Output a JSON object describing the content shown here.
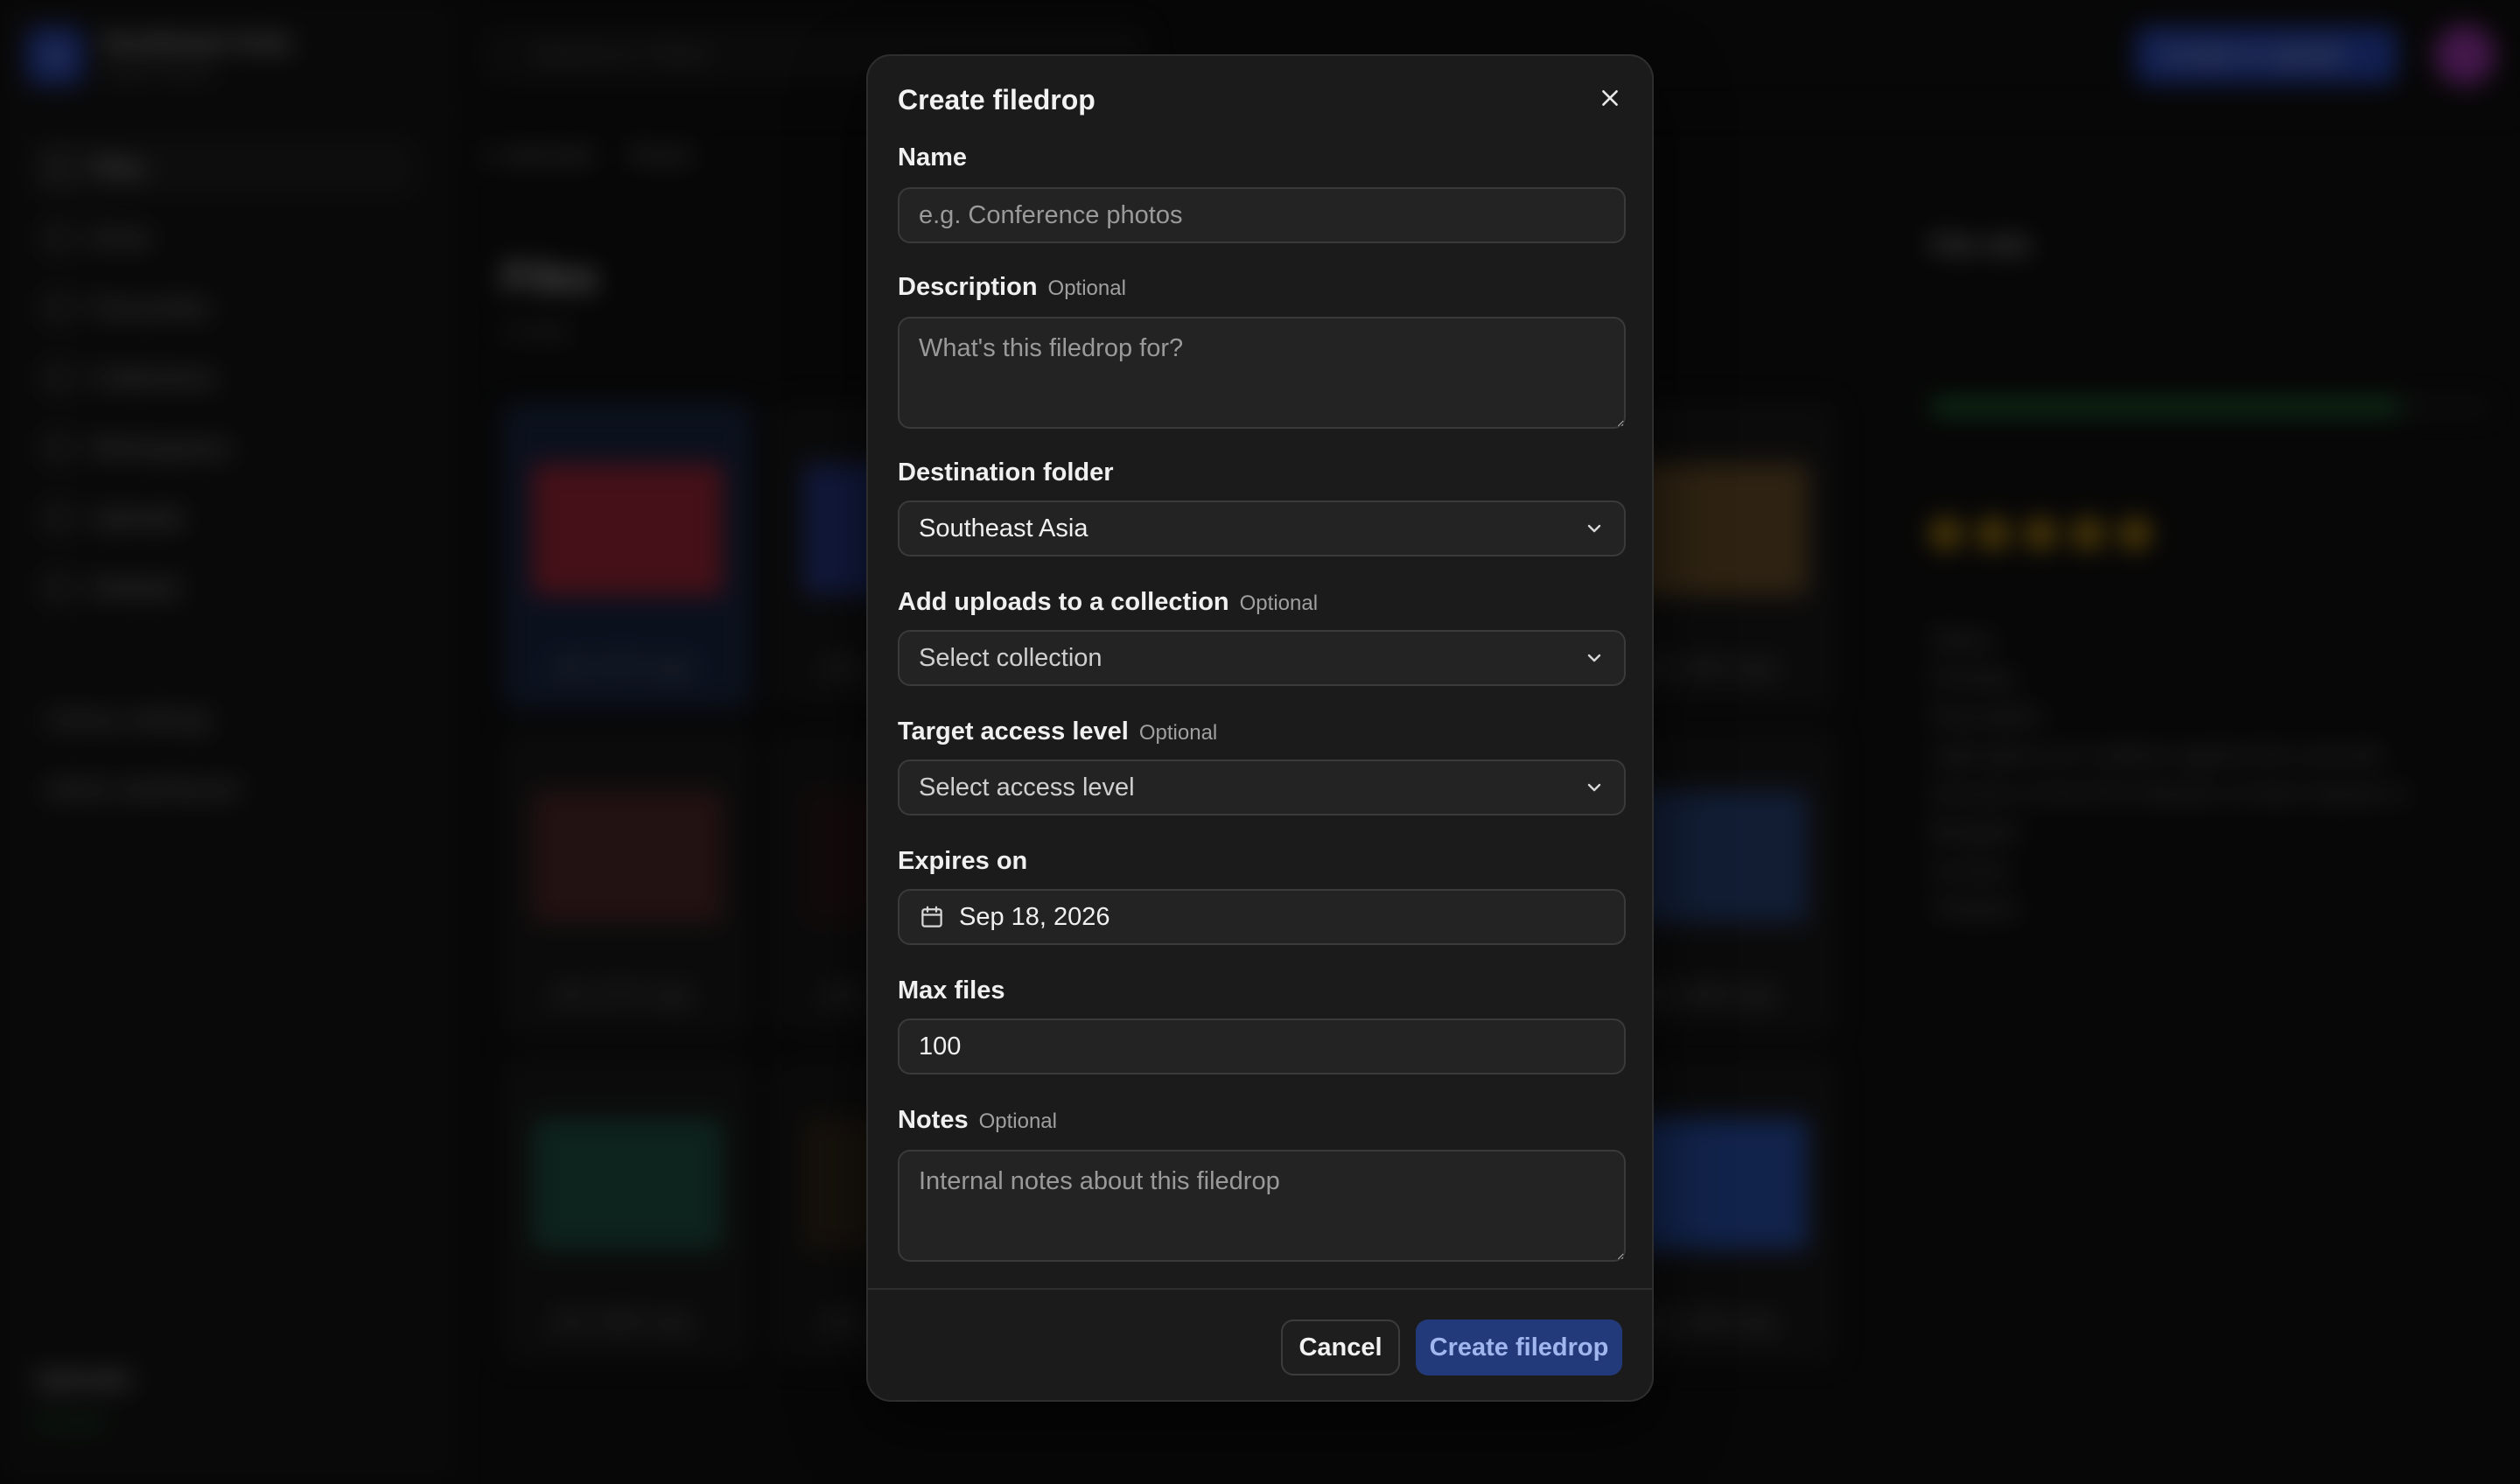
{
  "background": {
    "workspace": {
      "name": "Southeast Asia",
      "subtitle": "Switch library",
      "logo_letter": "S"
    },
    "nav": [
      "Files",
      "Drive",
      "Favourites",
      "Collections",
      "Workspaces",
      "Uploads",
      "Deleted"
    ],
    "nav_extra": [
      "Library settings",
      "Admin dashboard"
    ],
    "uploads_footer": {
      "title": "Uploads",
      "status": "All done"
    },
    "search_placeholder": "Search in \"Files\"",
    "upload_button": "Create or upload",
    "toolbar": [
      "1 selected",
      "Share"
    ],
    "main_title": "Files",
    "main_count": "24 files",
    "tiles": [
      {
        "caption": "_MG_6797-e.jpg",
        "color": "#b8263a"
      },
      {
        "caption": "_MG_",
        "color": "#2a3fa0"
      },
      {
        "caption": "",
        "color": "#222222"
      },
      {
        "caption": "",
        "color": "#222222"
      },
      {
        "caption": "_MG_6825-e.jpg",
        "color": "#7a5a2c"
      },
      {
        "caption": "_MG_6797-e.jpg",
        "color": "#5a2a2a"
      },
      {
        "caption": "_MG_",
        "color": "#301818"
      },
      {
        "caption": "",
        "color": "#222222"
      },
      {
        "caption": "",
        "color": "#222222"
      },
      {
        "caption": "_MG_6896-e.jpg",
        "color": "#2a4a8a"
      },
      {
        "caption": "_MG_6984-e.jpg",
        "color": "#1e5a4a"
      },
      {
        "caption": "_MG_",
        "color": "#3a2a1a"
      },
      {
        "caption": "",
        "color": "#222222"
      },
      {
        "caption": "",
        "color": "#222222"
      },
      {
        "caption": "_MG_6296-e.jpg",
        "color": "#2a5ac8"
      }
    ],
    "right_panel": {
      "title": "File info",
      "health_label": "Metadata health",
      "health_percent": 84,
      "rating": 5,
      "status_label": "Status",
      "status_value": "Pending",
      "description_label": "Description",
      "description": "Light glows as it reflects against the concrete structure of the BTS Skytrain at Siam Square in Bangkok.",
      "country_label": "Country",
      "country_value": "Thailand"
    }
  },
  "modal": {
    "title": "Create filedrop",
    "optional_text": "Optional",
    "fields": {
      "name": {
        "label": "Name",
        "placeholder": "e.g. Conference photos",
        "value": ""
      },
      "description": {
        "label": "Description",
        "placeholder": "What's this filedrop for?",
        "value": ""
      },
      "destination": {
        "label": "Destination folder",
        "value": "Southeast Asia"
      },
      "collection": {
        "label": "Add uploads to a collection",
        "placeholder": "Select collection"
      },
      "access": {
        "label": "Target access level",
        "placeholder": "Select access level"
      },
      "expires": {
        "label": "Expires on",
        "value": "Sep 18, 2026"
      },
      "max_files": {
        "label": "Max files",
        "value": "100"
      },
      "notes": {
        "label": "Notes",
        "placeholder": "Internal notes about this filedrop",
        "value": ""
      }
    },
    "buttons": {
      "cancel": "Cancel",
      "create": "Create filedrop"
    }
  },
  "icons": {
    "close": "close-icon",
    "chevron": "chevron-down-icon",
    "calendar": "calendar-icon"
  },
  "colors": {
    "modal_bg": "#1b1b1b",
    "input_bg": "#232323",
    "primary_button": "#233a7a",
    "primary_text": "#9fb6ee"
  }
}
